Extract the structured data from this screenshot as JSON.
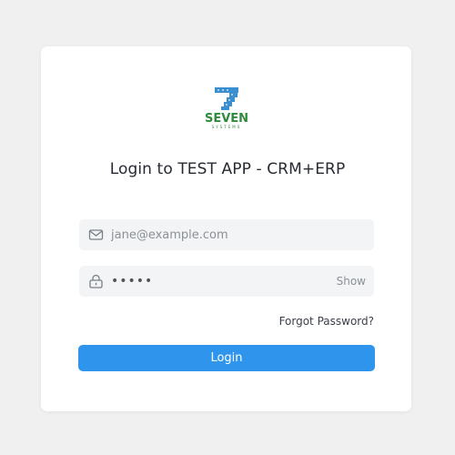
{
  "brand": {
    "name": "SEVEN",
    "tagline": "SYSTEMS",
    "color": "#2f8a3a",
    "accent": "#3a8fd0"
  },
  "login": {
    "title": "Login to TEST APP - CRM+ERP",
    "email_placeholder": "jane@example.com",
    "email_value": "",
    "password_value": "•••••",
    "show_label": "Show",
    "forgot_label": "Forgot Password?",
    "submit_label": "Login",
    "email_icon": "mail-icon",
    "password_icon": "lock-icon",
    "accent_color": "#2f95ec"
  }
}
